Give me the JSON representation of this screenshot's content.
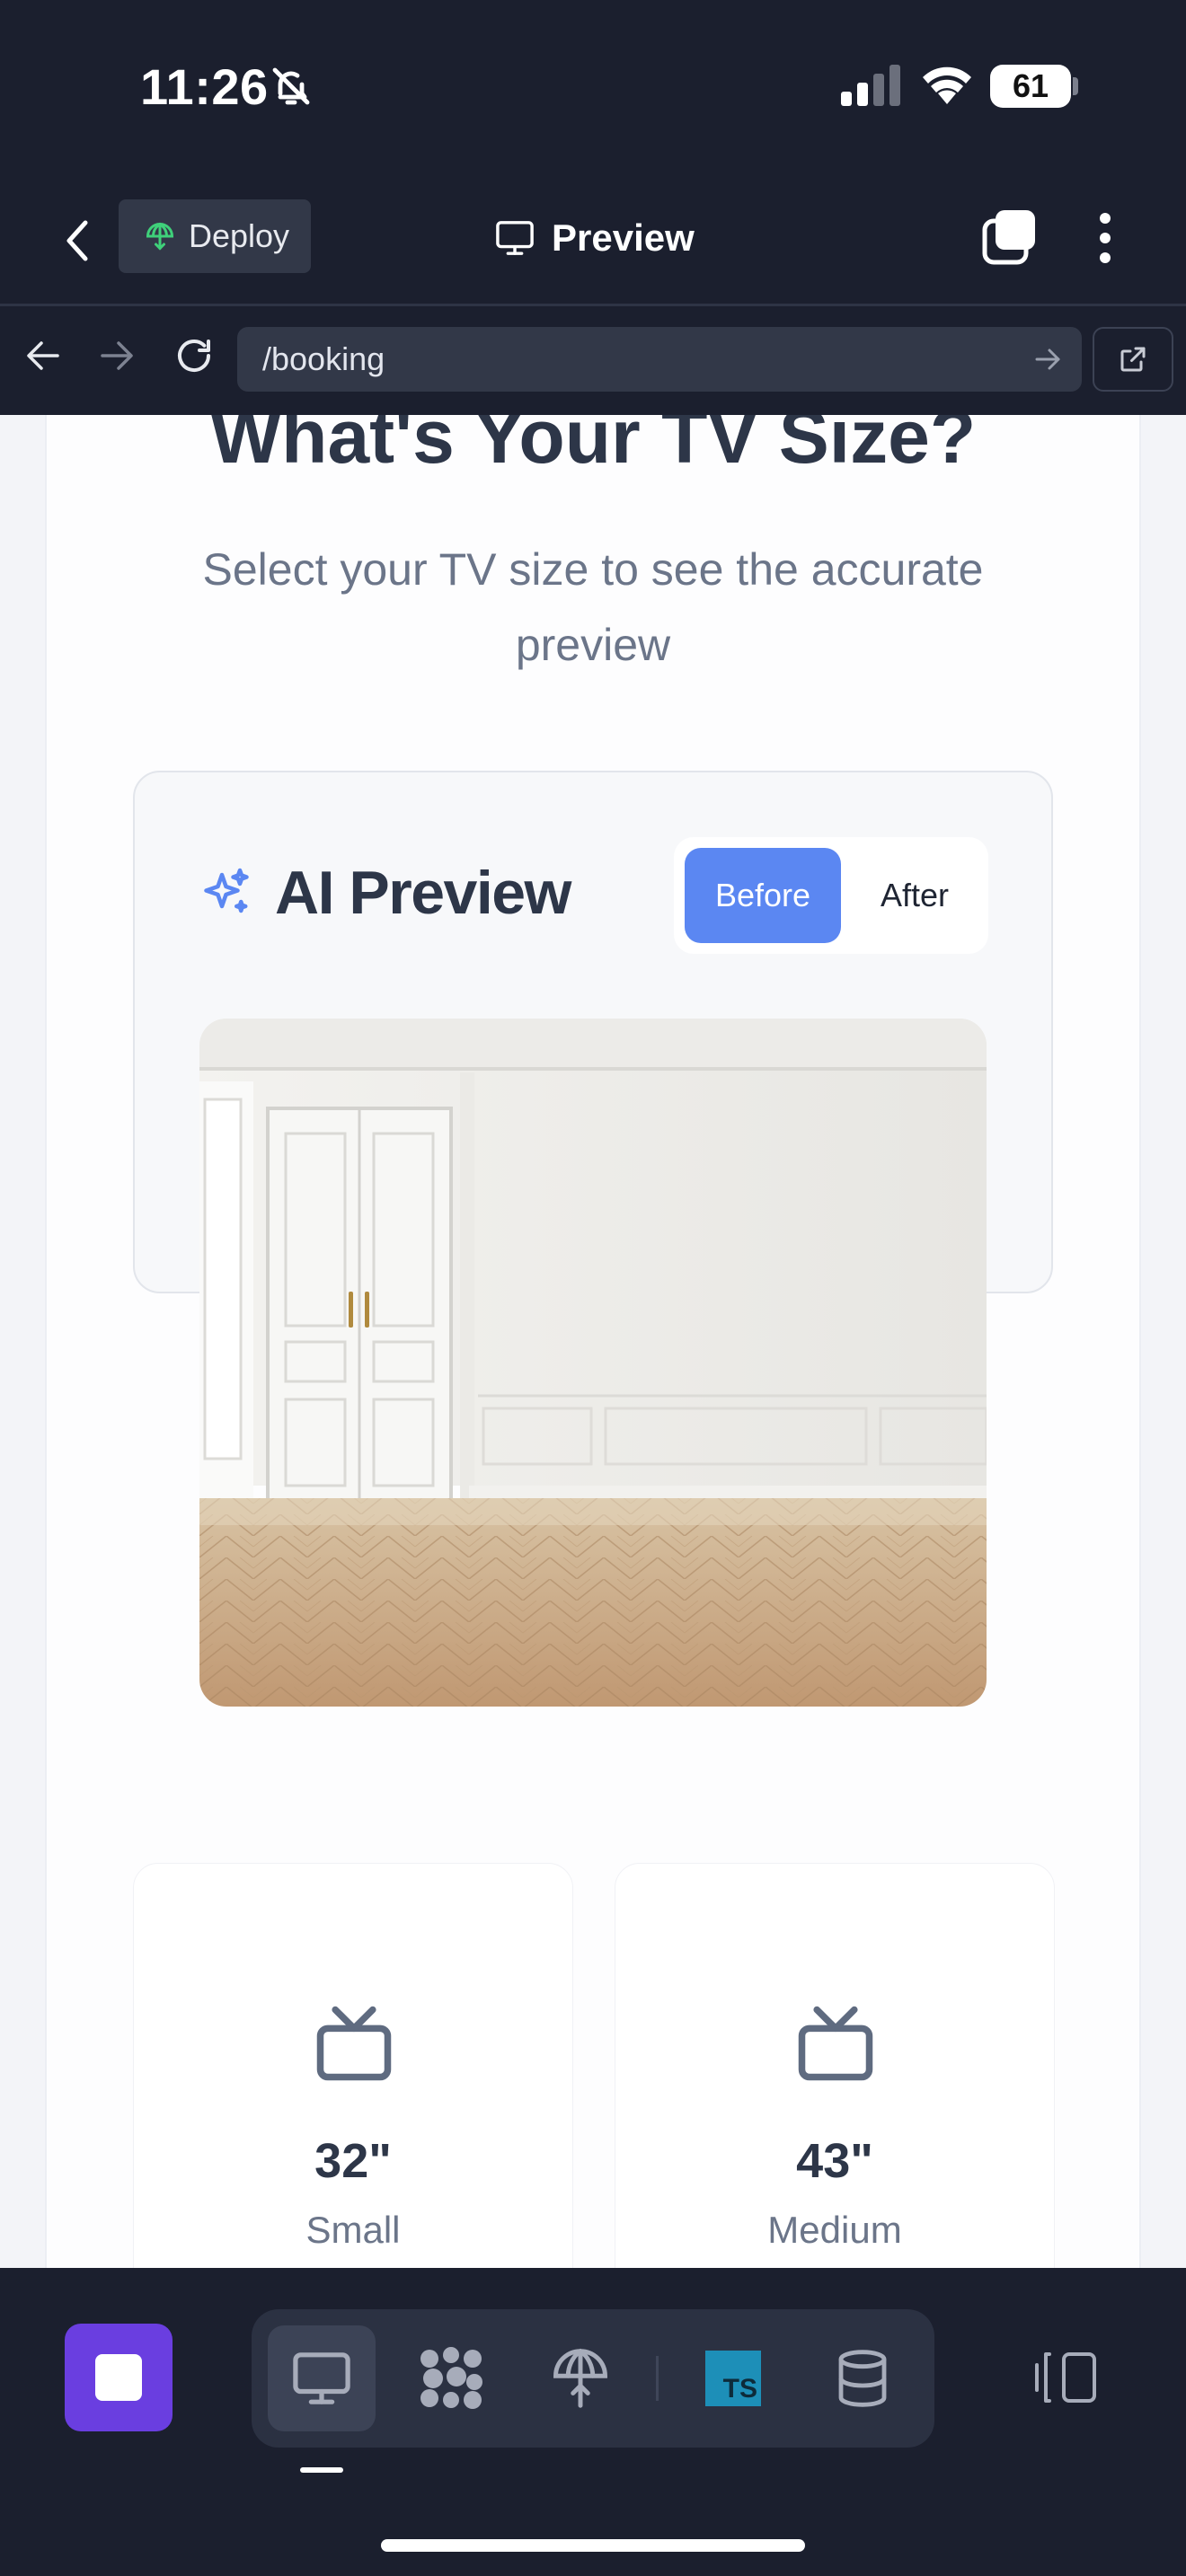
{
  "status_bar": {
    "time": "11:26",
    "battery": "61"
  },
  "header": {
    "deploy_label": "Deploy",
    "title": "Preview"
  },
  "browser": {
    "url": "/booking"
  },
  "page": {
    "heading": "What's Your TV Size?",
    "subtitle": "Select your TV size to see the accurate preview",
    "ai_preview": {
      "title": "AI Preview",
      "toggle_before": "Before",
      "toggle_after": "After",
      "selected": "Before"
    },
    "sizes": [
      {
        "value": "32\"",
        "label": "Small"
      },
      {
        "value": "43\"",
        "label": "Medium"
      }
    ]
  },
  "dock": {
    "tools": [
      "preview-icon",
      "nodes-icon",
      "deploy-icon",
      "typescript-icon",
      "database-icon"
    ],
    "ts_badge": "TS",
    "active_tool": "preview"
  },
  "colors": {
    "accent": "#5b87f2",
    "stop_button": "#6a3ee0",
    "chrome_bg": "#1b1f2e",
    "heading_text": "#2d3648"
  }
}
